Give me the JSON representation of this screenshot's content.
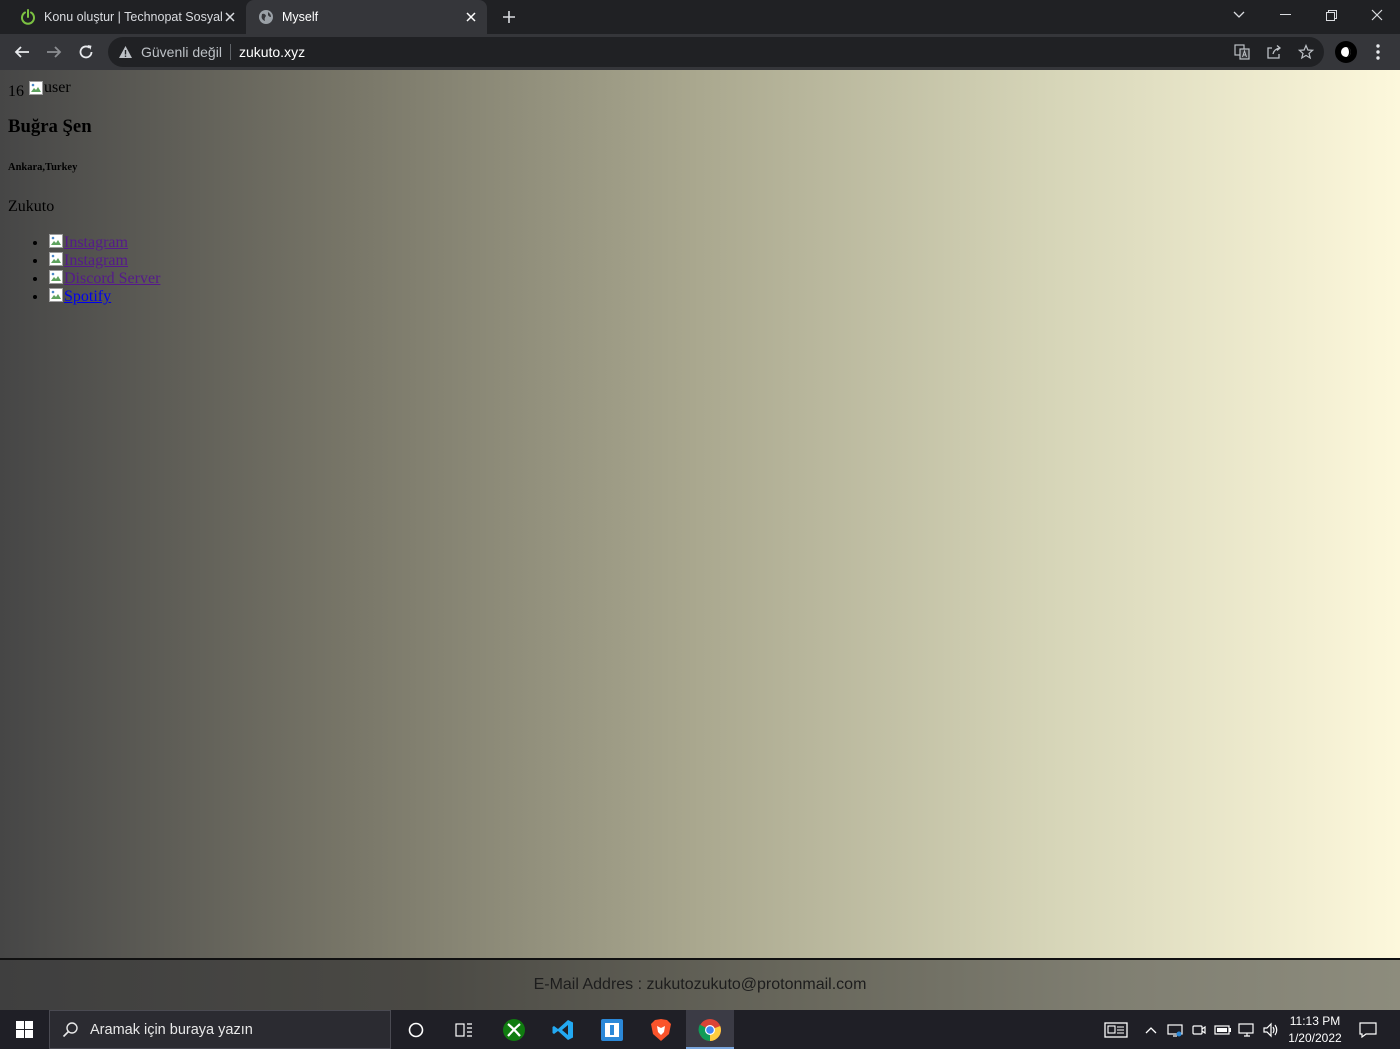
{
  "browser": {
    "tabs": [
      {
        "title": "Konu oluştur | Technopat Sosyal",
        "active": false
      },
      {
        "title": "Myself",
        "active": true
      }
    ],
    "security_label": "Güvenli değil",
    "url": "zukuto.xyz",
    "accent_color": "#8ab4f8"
  },
  "page": {
    "age": "16",
    "avatar_alt": "user",
    "name": "Buğra Şen",
    "location": "Ankara,Turkey",
    "nickname": "Zukuto",
    "links": [
      {
        "label": "Instagram"
      },
      {
        "label": "Instagram"
      },
      {
        "label": "Discord Server"
      },
      {
        "label": "Spotify"
      }
    ],
    "footer_email": "E-Mail Addres : zukutozukuto@protonmail.com"
  },
  "taskbar": {
    "search_placeholder": "Aramak için buraya yazın",
    "time": "11:13 PM",
    "date": "1/20/2022"
  }
}
